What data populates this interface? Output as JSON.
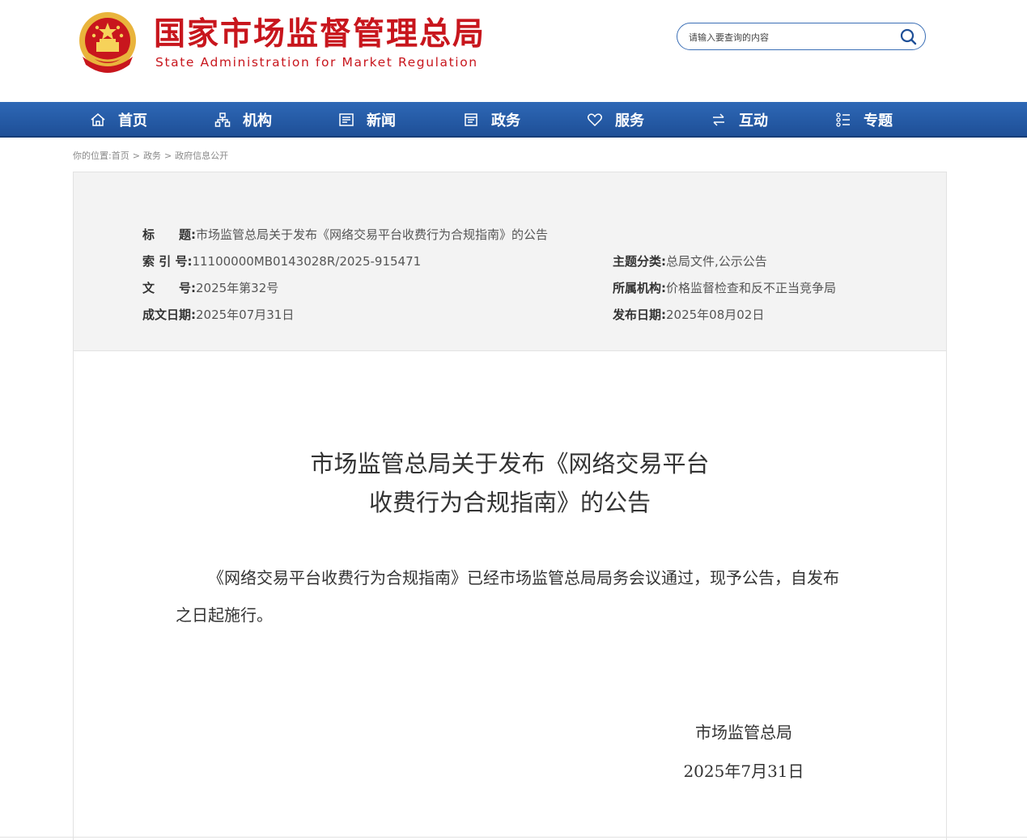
{
  "header": {
    "title": "国家市场监督管理总局",
    "subtitle": "State Administration for Market Regulation",
    "search_placeholder": "请输入要查询的内容"
  },
  "nav": [
    {
      "label": "首页",
      "icon": "home-icon"
    },
    {
      "label": "机构",
      "icon": "org-chart-icon"
    },
    {
      "label": "新闻",
      "icon": "newspaper-icon"
    },
    {
      "label": "政务",
      "icon": "document-icon"
    },
    {
      "label": "服务",
      "icon": "heart-icon"
    },
    {
      "label": "互动",
      "icon": "exchange-icon"
    },
    {
      "label": "专题",
      "icon": "list-icon"
    }
  ],
  "breadcrumb": {
    "prefix": "你的位置:",
    "items": [
      "首页",
      "政务",
      "政府信息公开"
    ],
    "separator": ">"
  },
  "meta": {
    "title_label": "标　　题:",
    "title_value": "市场监管总局关于发布《网络交易平台收费行为合规指南》的公告",
    "index_label": "索 引 号:",
    "index_value": "11100000MB0143028R/2025-915471",
    "docno_label": "文　　号:",
    "docno_value": "2025年第32号",
    "written_label": "成文日期:",
    "written_value": "2025年07月31日",
    "category_label": "主题分类:",
    "category_value": "总局文件,公示公告",
    "agency_label": "所属机构:",
    "agency_value": "价格监督检查和反不正当竞争局",
    "published_label": "发布日期:",
    "published_value": "2025年08月02日"
  },
  "article": {
    "title_line1": "市场监管总局关于发布《网络交易平台",
    "title_line2": "收费行为合规指南》的公告",
    "body": "《网络交易平台收费行为合规指南》已经市场监管总局局务会议通过，现予公告，自发布之日起施行。",
    "signature_org": "市场监管总局",
    "signature_date": "2025年7月31日"
  },
  "colors": {
    "brand_red": "#c8161d",
    "nav_blue": "#2e68b6",
    "meta_bg": "#f3f3f3"
  }
}
